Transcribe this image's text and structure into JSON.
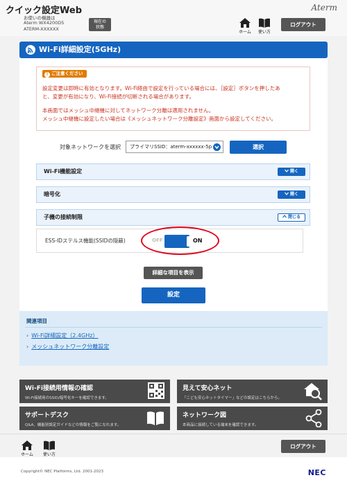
{
  "header": {
    "title": "クイック設定Web",
    "device_lines": [
      "お使いの機器は",
      "Aterm WX4200D5",
      "ATERM-XXXXXX"
    ],
    "status_button": [
      "現在の",
      "状態"
    ],
    "brand": "Aterm",
    "home_label": "ホーム",
    "manual_label": "使い方",
    "logout_label": "ログアウト"
  },
  "page": {
    "title": "Wi-Fi詳細設定(5GHz)"
  },
  "caution": {
    "badge": "ご注意ください",
    "lines": [
      "設定変更は即時に有効となります。Wi-Fi経由で設定を行っている場合には、［設定］ボタンを押したあ",
      "と、変更が有効になり、Wi-Fi接続が切断される場合があります。",
      "本画面ではメッシュ中継機に対してネットワーク分離は適用されません。",
      "メッシュ中継機に設定したい場合は《メッシュネットワーク分離設定》画面から設定してください。"
    ]
  },
  "network_select": {
    "label": "対象ネットワークを選択",
    "value": "プライマリSSID：aterm-xxxxxx-5p",
    "button": "選択"
  },
  "sections": [
    {
      "title": "Wi-Fi機能設定",
      "button": "開く"
    },
    {
      "title": "暗号化",
      "button": "開く"
    },
    {
      "title": "子機の接続制限",
      "button": "閉じる"
    }
  ],
  "stealth": {
    "label": "ESS-IDステルス機能(SSIDの隠蔽)",
    "off": "OFF",
    "on": "ON",
    "state_on": true
  },
  "buttons": {
    "show_detail": "詳細な項目を表示",
    "apply": "設定"
  },
  "related": {
    "title": "関連項目",
    "links": [
      "Wi-Fi詳細設定（2.4GHz）",
      "メッシュネットワーク分離設定"
    ]
  },
  "tiles": [
    {
      "title": "Wi-Fi接続用情報の確認",
      "sub": "Wi-Fi接続用のSSID/暗号化キーを確認できます。",
      "icon": "qr-code-icon"
    },
    {
      "title": "見えて安心ネット",
      "sub": "「こども安心ネットタイマー」などの設定はこちらから。",
      "icon": "house-search-icon"
    },
    {
      "title": "サポートデスク",
      "sub": "Q&A、機能別設定ガイドなどの情報をご覧になれます。",
      "icon": "book-icon"
    },
    {
      "title": "ネットワーク図",
      "sub": "本商品に接続している端末を確認できます。",
      "icon": "share-network-icon"
    }
  ],
  "footer": {
    "home_label": "ホーム",
    "manual_label": "使い方",
    "logout_label": "ログアウト",
    "copyright": "Copyright© NEC Platforms, Ltd. 2001-2023",
    "logo": "NEC"
  },
  "colors": {
    "primary": "#1565c0",
    "dark_button": "#555555",
    "caution_text": "#c8321e",
    "highlight_ring": "#e0001a"
  }
}
